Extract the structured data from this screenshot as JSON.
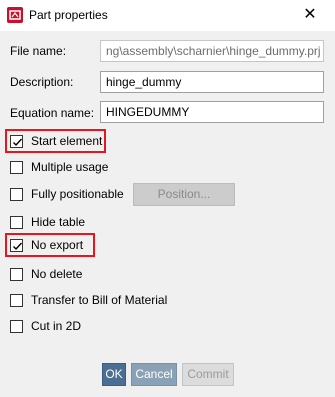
{
  "window": {
    "title": "Part properties",
    "close_glyph": "✕"
  },
  "fields": {
    "file_name": {
      "label": "File name:",
      "value": "ng\\assembly\\scharnier\\hinge_dummy.prj"
    },
    "description": {
      "label": "Description:",
      "value": "hinge_dummy"
    },
    "equation_name": {
      "label": "Equation name:",
      "value": "HINGEDUMMY"
    }
  },
  "options": [
    {
      "label": "Start element",
      "checked": true
    },
    {
      "label": "Multiple usage",
      "checked": false
    },
    {
      "label": "Fully positionable",
      "checked": false
    },
    {
      "label": "Hide table",
      "checked": false
    },
    {
      "label": "No export",
      "checked": true
    },
    {
      "label": "No delete",
      "checked": false
    },
    {
      "label": "Transfer to Bill of Material",
      "checked": false
    },
    {
      "label": "Cut in 2D",
      "checked": false
    }
  ],
  "buttons": {
    "position": "Position...",
    "ok": "OK",
    "cancel": "Cancel",
    "commit": "Commit"
  },
  "colors": {
    "highlight": "#e8141e",
    "ok_button": "#4a6f92",
    "cancel_button": "#8aa2b6"
  }
}
